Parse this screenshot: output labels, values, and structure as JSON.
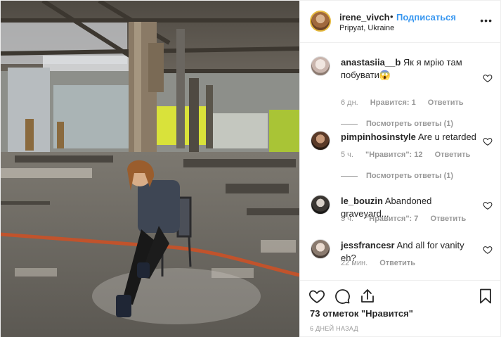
{
  "post": {
    "username": "irene_vivch",
    "separator": "•",
    "follow_label": "Подписаться",
    "location": "Pripyat, Ukraine",
    "more_icon": "ellipsis-icon",
    "photo_description_icon": "post-photo"
  },
  "comments": [
    {
      "username": "anastasiia__b",
      "text": "Як я мрію там побувати😱",
      "time": "6 дн.",
      "likes_label": "Нравится: 1",
      "reply_label": "Ответить",
      "replies_label": "Посмотреть ответы (1)"
    },
    {
      "username": "pimpinhosinstyle",
      "text": "Are u retarded",
      "time": "5 ч.",
      "likes_label": "\"Нравится\": 12",
      "reply_label": "Ответить",
      "replies_label": "Посмотреть ответы (1)"
    },
    {
      "username": "le_bouzin",
      "text": "Abandoned graveyard...",
      "time": "3 ч.",
      "likes_label": "\"Нравится\": 7",
      "reply_label": "Ответить",
      "replies_label": ""
    },
    {
      "username": "jessfrancesr",
      "text": "And all for vanity eh?",
      "time": "22 мин.",
      "likes_label": "",
      "reply_label": "Ответить",
      "replies_label": ""
    }
  ],
  "actions": {
    "like_icon": "heart-icon",
    "comment_icon": "comment-icon",
    "share_icon": "share-icon",
    "save_icon": "bookmark-icon",
    "likes_text": "73 отметок \"Нравится\"",
    "timestamp": "6 ДНЕЙ НАЗАД"
  },
  "colors": {
    "link_blue": "#3897f0",
    "text": "#262626",
    "muted": "#999999",
    "border": "#efefef"
  }
}
